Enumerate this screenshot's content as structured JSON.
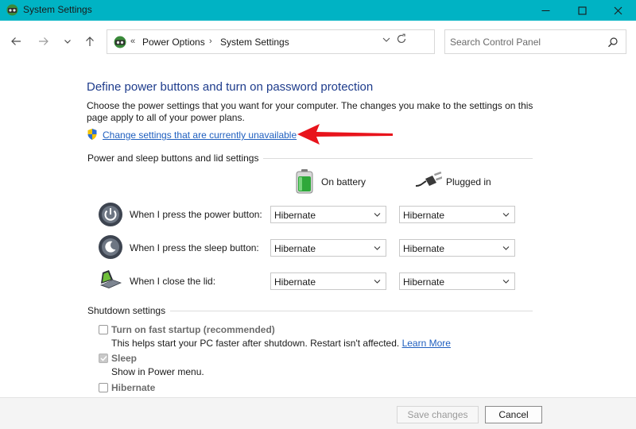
{
  "window": {
    "title": "System Settings",
    "accent_color": "#00b3c4"
  },
  "nav": {
    "breadcrumbs": [
      "Power Options",
      "System Settings"
    ],
    "breadcrumb_overflow": "«",
    "search_placeholder": "Search Control Panel"
  },
  "page": {
    "heading": "Define power buttons and turn on password protection",
    "description": "Choose the power settings that you want for your computer. The changes you make to the settings on this page apply to all of your power plans.",
    "change_link": "Change settings that are currently unavailable",
    "link_color": "#1f5fbf",
    "heading_color": "#1e3c8c"
  },
  "power_section": {
    "title": "Power and sleep buttons and lid settings",
    "columns": [
      "On battery",
      "Plugged in"
    ],
    "rows": [
      {
        "label": "When I press the power button:",
        "on_battery": "Hibernate",
        "plugged_in": "Hibernate",
        "icon": "power-button-icon"
      },
      {
        "label": "When I press the sleep button:",
        "on_battery": "Hibernate",
        "plugged_in": "Hibernate",
        "icon": "sleep-button-icon"
      },
      {
        "label": "When I close the lid:",
        "on_battery": "Hibernate",
        "plugged_in": "Hibernate",
        "icon": "laptop-lid-icon"
      }
    ]
  },
  "shutdown_section": {
    "title": "Shutdown settings",
    "options": [
      {
        "label": "Turn on fast startup (recommended)",
        "description": "This helps start your PC faster after shutdown. Restart isn't affected.",
        "link": "Learn More",
        "checked": false,
        "disabled": true
      },
      {
        "label": "Sleep",
        "description": "Show in Power menu.",
        "checked": true,
        "disabled": true
      },
      {
        "label": "Hibernate",
        "checked": false,
        "disabled": false
      }
    ]
  },
  "footer": {
    "save_label": "Save changes",
    "cancel_label": "Cancel"
  },
  "annotation": {
    "arrow_color": "#e8141c"
  }
}
